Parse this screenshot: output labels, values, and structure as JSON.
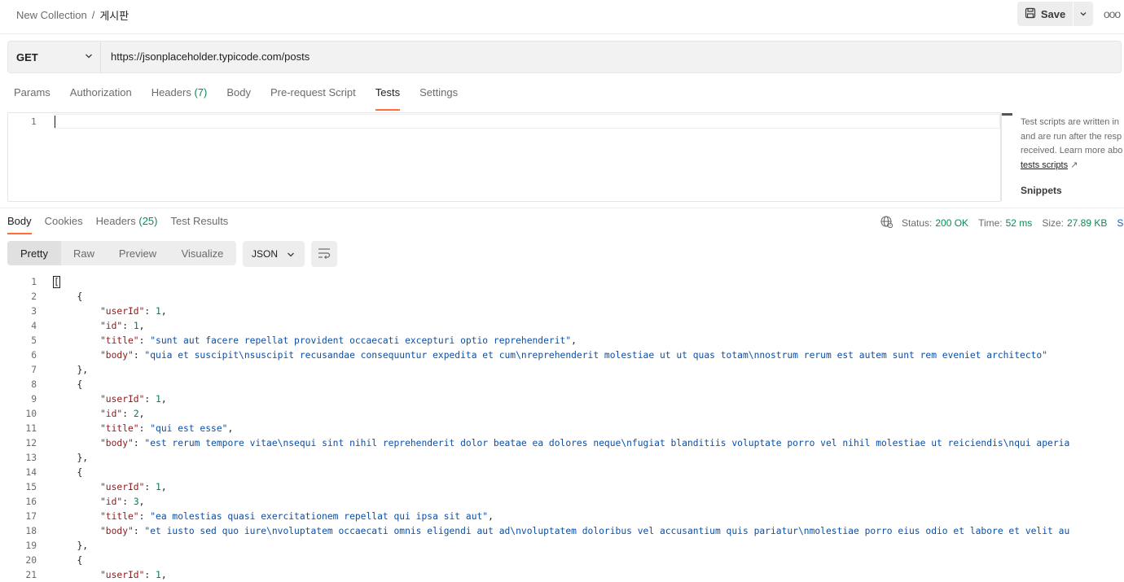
{
  "breadcrumb": {
    "collection": "New Collection",
    "separator": "/",
    "request": "게시판"
  },
  "toolbar": {
    "save_label": "Save",
    "more_label": "ooo"
  },
  "request": {
    "method": "GET",
    "url": "https://jsonplaceholder.typicode.com/posts"
  },
  "request_tabs": [
    {
      "label": "Params",
      "count": ""
    },
    {
      "label": "Authorization",
      "count": ""
    },
    {
      "label": "Headers",
      "count": "(7)"
    },
    {
      "label": "Body",
      "count": ""
    },
    {
      "label": "Pre-request Script",
      "count": ""
    },
    {
      "label": "Tests",
      "count": "",
      "active": true
    },
    {
      "label": "Settings",
      "count": ""
    }
  ],
  "editor": {
    "line_number": "1"
  },
  "side_help": {
    "line1": "Test scripts are written in",
    "line2": "and are run after the resp",
    "line3": "received. Learn more abo",
    "link": "tests scripts",
    "link_arrow": "↗",
    "snippets": "Snippets"
  },
  "response_tabs": [
    {
      "label": "Body",
      "count": "",
      "active": true
    },
    {
      "label": "Cookies",
      "count": ""
    },
    {
      "label": "Headers",
      "count": "(25)"
    },
    {
      "label": "Test Results",
      "count": ""
    }
  ],
  "status": {
    "status_label": "Status:",
    "status_value": "200 OK",
    "time_label": "Time:",
    "time_value": "52 ms",
    "size_label": "Size:",
    "size_value": "27.89 KB",
    "truncated": "S"
  },
  "view_modes": [
    "Pretty",
    "Raw",
    "Preview",
    "Visualize"
  ],
  "format": "JSON",
  "response_lines": [
    {
      "n": "1",
      "indent": 0,
      "parts": [
        [
          "bracket",
          "["
        ]
      ]
    },
    {
      "n": "2",
      "indent": 1,
      "parts": [
        [
          "punc",
          "{"
        ]
      ]
    },
    {
      "n": "3",
      "indent": 2,
      "parts": [
        [
          "key",
          "\"userId\""
        ],
        [
          "punc",
          ": "
        ],
        [
          "num",
          "1"
        ],
        [
          "punc",
          ","
        ]
      ]
    },
    {
      "n": "4",
      "indent": 2,
      "parts": [
        [
          "key",
          "\"id\""
        ],
        [
          "punc",
          ": "
        ],
        [
          "num",
          "1"
        ],
        [
          "punc",
          ","
        ]
      ]
    },
    {
      "n": "5",
      "indent": 2,
      "parts": [
        [
          "key",
          "\"title\""
        ],
        [
          "punc",
          ": "
        ],
        [
          "str",
          "\"sunt aut facere repellat provident occaecati excepturi optio reprehenderit\""
        ],
        [
          "punc",
          ","
        ]
      ]
    },
    {
      "n": "6",
      "indent": 2,
      "parts": [
        [
          "key",
          "\"body\""
        ],
        [
          "punc",
          ": "
        ],
        [
          "str",
          "\"quia et suscipit\\nsuscipit recusandae consequuntur expedita et cum\\nreprehenderit molestiae ut ut quas totam\\nnostrum rerum est autem sunt rem eveniet architecto\""
        ]
      ]
    },
    {
      "n": "7",
      "indent": 1,
      "parts": [
        [
          "punc",
          "},"
        ]
      ]
    },
    {
      "n": "8",
      "indent": 1,
      "parts": [
        [
          "punc",
          "{"
        ]
      ]
    },
    {
      "n": "9",
      "indent": 2,
      "parts": [
        [
          "key",
          "\"userId\""
        ],
        [
          "punc",
          ": "
        ],
        [
          "num",
          "1"
        ],
        [
          "punc",
          ","
        ]
      ]
    },
    {
      "n": "10",
      "indent": 2,
      "parts": [
        [
          "key",
          "\"id\""
        ],
        [
          "punc",
          ": "
        ],
        [
          "num",
          "2"
        ],
        [
          "punc",
          ","
        ]
      ]
    },
    {
      "n": "11",
      "indent": 2,
      "parts": [
        [
          "key",
          "\"title\""
        ],
        [
          "punc",
          ": "
        ],
        [
          "str",
          "\"qui est esse\""
        ],
        [
          "punc",
          ","
        ]
      ]
    },
    {
      "n": "12",
      "indent": 2,
      "parts": [
        [
          "key",
          "\"body\""
        ],
        [
          "punc",
          ": "
        ],
        [
          "str",
          "\"est rerum tempore vitae\\nsequi sint nihil reprehenderit dolor beatae ea dolores neque\\nfugiat blanditiis voluptate porro vel nihil molestiae ut reiciendis\\nqui aperia"
        ]
      ]
    },
    {
      "n": "13",
      "indent": 1,
      "parts": [
        [
          "punc",
          "},"
        ]
      ]
    },
    {
      "n": "14",
      "indent": 1,
      "parts": [
        [
          "punc",
          "{"
        ]
      ]
    },
    {
      "n": "15",
      "indent": 2,
      "parts": [
        [
          "key",
          "\"userId\""
        ],
        [
          "punc",
          ": "
        ],
        [
          "num",
          "1"
        ],
        [
          "punc",
          ","
        ]
      ]
    },
    {
      "n": "16",
      "indent": 2,
      "parts": [
        [
          "key",
          "\"id\""
        ],
        [
          "punc",
          ": "
        ],
        [
          "num",
          "3"
        ],
        [
          "punc",
          ","
        ]
      ]
    },
    {
      "n": "17",
      "indent": 2,
      "parts": [
        [
          "key",
          "\"title\""
        ],
        [
          "punc",
          ": "
        ],
        [
          "str",
          "\"ea molestias quasi exercitationem repellat qui ipsa sit aut\""
        ],
        [
          "punc",
          ","
        ]
      ]
    },
    {
      "n": "18",
      "indent": 2,
      "parts": [
        [
          "key",
          "\"body\""
        ],
        [
          "punc",
          ": "
        ],
        [
          "str",
          "\"et iusto sed quo iure\\nvoluptatem occaecati omnis eligendi aut ad\\nvoluptatem doloribus vel accusantium quis pariatur\\nmolestiae porro eius odio et labore et velit au"
        ]
      ]
    },
    {
      "n": "19",
      "indent": 1,
      "parts": [
        [
          "punc",
          "},"
        ]
      ]
    },
    {
      "n": "20",
      "indent": 1,
      "parts": [
        [
          "punc",
          "{"
        ]
      ]
    },
    {
      "n": "21",
      "indent": 2,
      "parts": [
        [
          "key",
          "\"userId\""
        ],
        [
          "punc",
          ": "
        ],
        [
          "num",
          "1"
        ],
        [
          "punc",
          ","
        ]
      ]
    }
  ],
  "colors": {
    "accent": "#ff6c37",
    "success": "#0b8a55",
    "link": "#0265d2"
  }
}
